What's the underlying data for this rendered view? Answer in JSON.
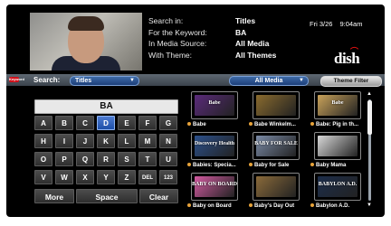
{
  "header": {
    "labels": [
      "Search in:",
      "For the Keyword:",
      "In Media Source:",
      "With Theme:"
    ],
    "values": [
      "Titles",
      "BA",
      "All Media",
      "All Themes"
    ],
    "date": "Fri 3/26",
    "time": "9:04am",
    "logo_text": "dish"
  },
  "toolbar": {
    "rec_label": "Keyword",
    "search_label": "Search:",
    "search_value": "Titles",
    "media_value": "All Media",
    "theme_filter_label": "Theme Filter"
  },
  "keyboard": {
    "query": "BA",
    "rows": [
      [
        "A",
        "B",
        "C",
        "D",
        "E",
        "F",
        "G"
      ],
      [
        "H",
        "I",
        "J",
        "K",
        "L",
        "M",
        "N"
      ],
      [
        "O",
        "P",
        "Q",
        "R",
        "S",
        "T",
        "U"
      ],
      [
        "V",
        "W",
        "X",
        "Y",
        "Z",
        "DEL",
        "123"
      ]
    ],
    "selected_key": "D",
    "more_label": "More",
    "space_label": "Space",
    "clear_label": "Clear"
  },
  "results": [
    {
      "title": "Babe",
      "logo": "Babe",
      "color": "#5a2a7a"
    },
    {
      "title": "Babe Winkelm...",
      "logo": "",
      "color": "#8a6b2e"
    },
    {
      "title": "Babe: Pig in th...",
      "logo": "Babe",
      "color": "#c9a25a"
    },
    {
      "title": "Babies: Specia...",
      "logo": "Discovery Health",
      "color": "#2b4f8a"
    },
    {
      "title": "Baby for Sale",
      "logo": "BABY FOR SALE",
      "color": "#7a8aa6"
    },
    {
      "title": "Baby Mama",
      "logo": "",
      "color": "#d8d8d8"
    },
    {
      "title": "Baby on Board",
      "logo": "BABY ON BOARD",
      "color": "#d25aa0"
    },
    {
      "title": "Baby's Day Out",
      "logo": "",
      "color": "#8a6a3a"
    },
    {
      "title": "Babylon A.D.",
      "logo": "BABYLON A.D.",
      "color": "#1c2d4a"
    }
  ],
  "colors": {
    "background": "#000000",
    "selected_key": "#1e4fa8",
    "toolbar_dropdown": "#1d3f7a",
    "record_badge": "#d1111b"
  }
}
